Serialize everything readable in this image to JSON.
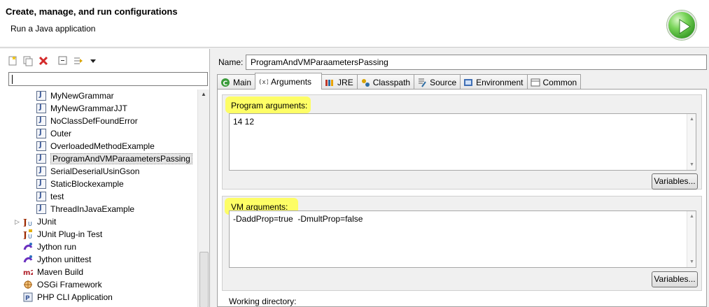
{
  "header": {
    "title": "Create, manage, and run configurations",
    "subtitle": "Run a Java application"
  },
  "left_panel": {
    "toolbar": [
      "new-launch-config-icon",
      "duplicate-icon",
      "delete-icon",
      "collapse-all-icon",
      "filter-icon",
      "view-menu-icon"
    ],
    "filter_value": "",
    "tree_items": [
      {
        "label": "MyNewGrammar",
        "icon": "java-class-icon"
      },
      {
        "label": "MyNewGrammarJJT",
        "icon": "java-class-icon"
      },
      {
        "label": "NoClassDefFoundError",
        "icon": "java-class-icon"
      },
      {
        "label": "Outer",
        "icon": "java-class-icon"
      },
      {
        "label": "OverloadedMethodExample",
        "icon": "java-class-icon"
      },
      {
        "label": "ProgramAndVMParaametersPassing",
        "icon": "java-class-icon",
        "selected": true
      },
      {
        "label": "SerialDeserialUsinGson",
        "icon": "java-class-icon"
      },
      {
        "label": "StaticBlockexample",
        "icon": "java-class-icon"
      },
      {
        "label": "test",
        "icon": "java-class-icon"
      },
      {
        "label": "ThreadInJavaExample",
        "icon": "java-class-icon"
      },
      {
        "label": "JUnit",
        "icon": "junit-icon",
        "top": true,
        "expandable": true
      },
      {
        "label": "JUnit Plug-in Test",
        "icon": "junit-plugin-icon",
        "top": true
      },
      {
        "label": "Jython run",
        "icon": "jython-icon",
        "top": true
      },
      {
        "label": "Jython unittest",
        "icon": "jython-icon",
        "top": true
      },
      {
        "label": "Maven Build",
        "icon": "maven-icon",
        "top": true
      },
      {
        "label": "OSGi Framework",
        "icon": "osgi-icon",
        "top": true
      },
      {
        "label": "PHP CLI Application",
        "icon": "php-icon",
        "top": true
      }
    ]
  },
  "right_panel": {
    "name_label": "Name:",
    "name_value": "ProgramAndVMParaametersPassing",
    "tabs": [
      {
        "label": "Main",
        "icon": "main-tab-icon"
      },
      {
        "label": "Arguments",
        "icon": "arguments-tab-icon",
        "active": true
      },
      {
        "label": "JRE",
        "icon": "jre-tab-icon"
      },
      {
        "label": "Classpath",
        "icon": "classpath-tab-icon"
      },
      {
        "label": "Source",
        "icon": "source-tab-icon"
      },
      {
        "label": "Environment",
        "icon": "environment-tab-icon"
      },
      {
        "label": "Common",
        "icon": "common-tab-icon"
      }
    ],
    "program_args_label": "Program arguments:",
    "program_args_value": "14 12",
    "vm_args_label": "VM arguments:",
    "vm_args_value": "-DaddProp=true  -DmultProp=false",
    "variables_label": "Variables...",
    "working_dir_label": "Working directory:",
    "highlight_color": "#ffff4d"
  }
}
